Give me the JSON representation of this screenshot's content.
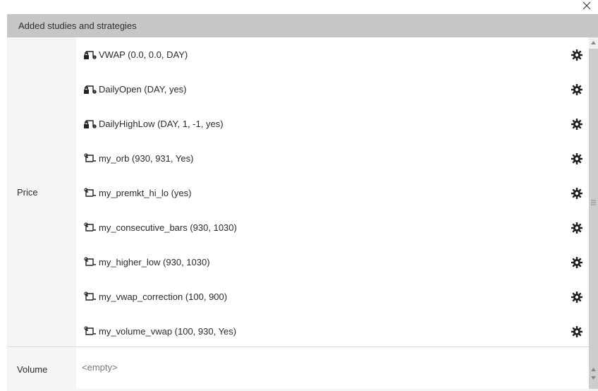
{
  "header": {
    "title": "Added studies and strategies"
  },
  "icons": {
    "close": "close-icon",
    "locked_script": "locked-script-icon",
    "script": "script-icon",
    "settings": "gear-icon"
  },
  "groups": {
    "price": {
      "label": "Price",
      "items": [
        {
          "label": "VWAP (0.0, 0.0, DAY)",
          "icon": "locked-script-icon"
        },
        {
          "label": "DailyOpen (DAY, yes)",
          "icon": "locked-script-icon"
        },
        {
          "label": "DailyHighLow (DAY, 1, -1, yes)",
          "icon": "locked-script-icon"
        },
        {
          "label": "my_orb (930, 931, Yes)",
          "icon": "script-icon"
        },
        {
          "label": "my_premkt_hi_lo (yes)",
          "icon": "script-icon"
        },
        {
          "label": "my_consecutive_bars (930, 1030)",
          "icon": "script-icon"
        },
        {
          "label": "my_higher_low (930, 1030)",
          "icon": "script-icon"
        },
        {
          "label": "my_vwap_correction (100, 900)",
          "icon": "script-icon"
        },
        {
          "label": "my_volume_vwap (100, 930, Yes)",
          "icon": "script-icon"
        }
      ]
    },
    "volume": {
      "label": "Volume",
      "empty_text": "<empty>"
    }
  }
}
